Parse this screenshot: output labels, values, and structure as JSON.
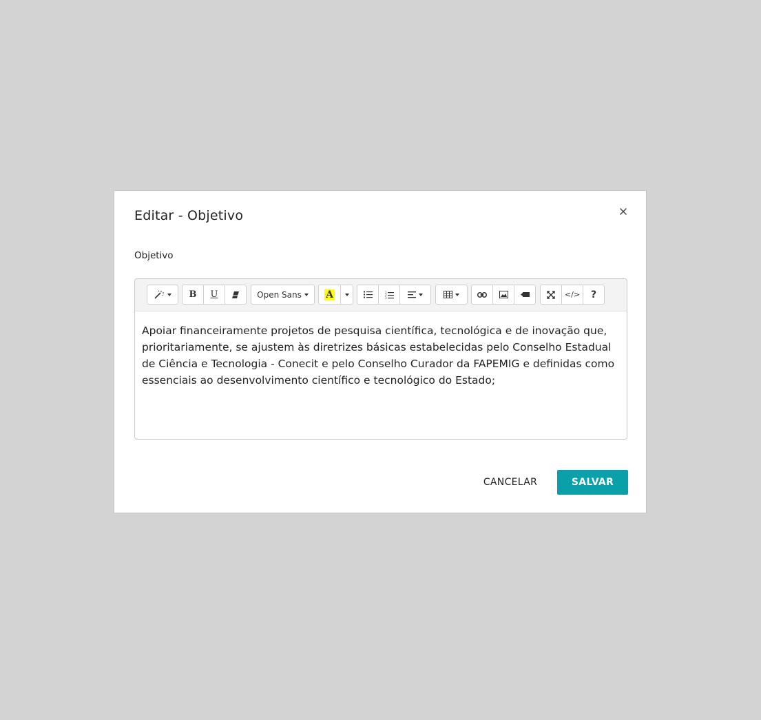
{
  "dialog": {
    "title": "Editar - Objetivo",
    "close_icon": "close-icon"
  },
  "field": {
    "label": "Objetivo"
  },
  "toolbar": {
    "style_icon": "magic-wand-icon",
    "bold_label": "B",
    "underline_label": "U",
    "clear_format_icon": "eraser-icon",
    "font_name": "Open Sans",
    "font_color_label": "A",
    "font_color_highlight": "#ffff00",
    "unordered_list_icon": "bullet-list-icon",
    "ordered_list_icon": "numbered-list-icon",
    "paragraph_icon": "align-left-icon",
    "table_icon": "table-icon",
    "link_icon": "link-icon",
    "picture_icon": "image-icon",
    "video_icon": "video-icon",
    "fullscreen_icon": "fullscreen-icon",
    "codeview_label": "</>",
    "help_label": "?"
  },
  "editor": {
    "content": "Apoiar financeiramente projetos de pesquisa científica, tecnológica e de inovação que, prioritariamente, se ajustem às diretrizes básicas estabelecidas pelo Conselho Estadual de Ciência e Tecnologia - Conecit e pelo Conselho Curador da FAPEMIG e definidas como essenciais ao desenvolvimento científico e tecnológico do Estado;"
  },
  "actions": {
    "cancel_label": "CANCELAR",
    "save_label": "SALVAR"
  },
  "colors": {
    "overlay": "#d3d3d3",
    "primary": "#0aa0aa"
  }
}
